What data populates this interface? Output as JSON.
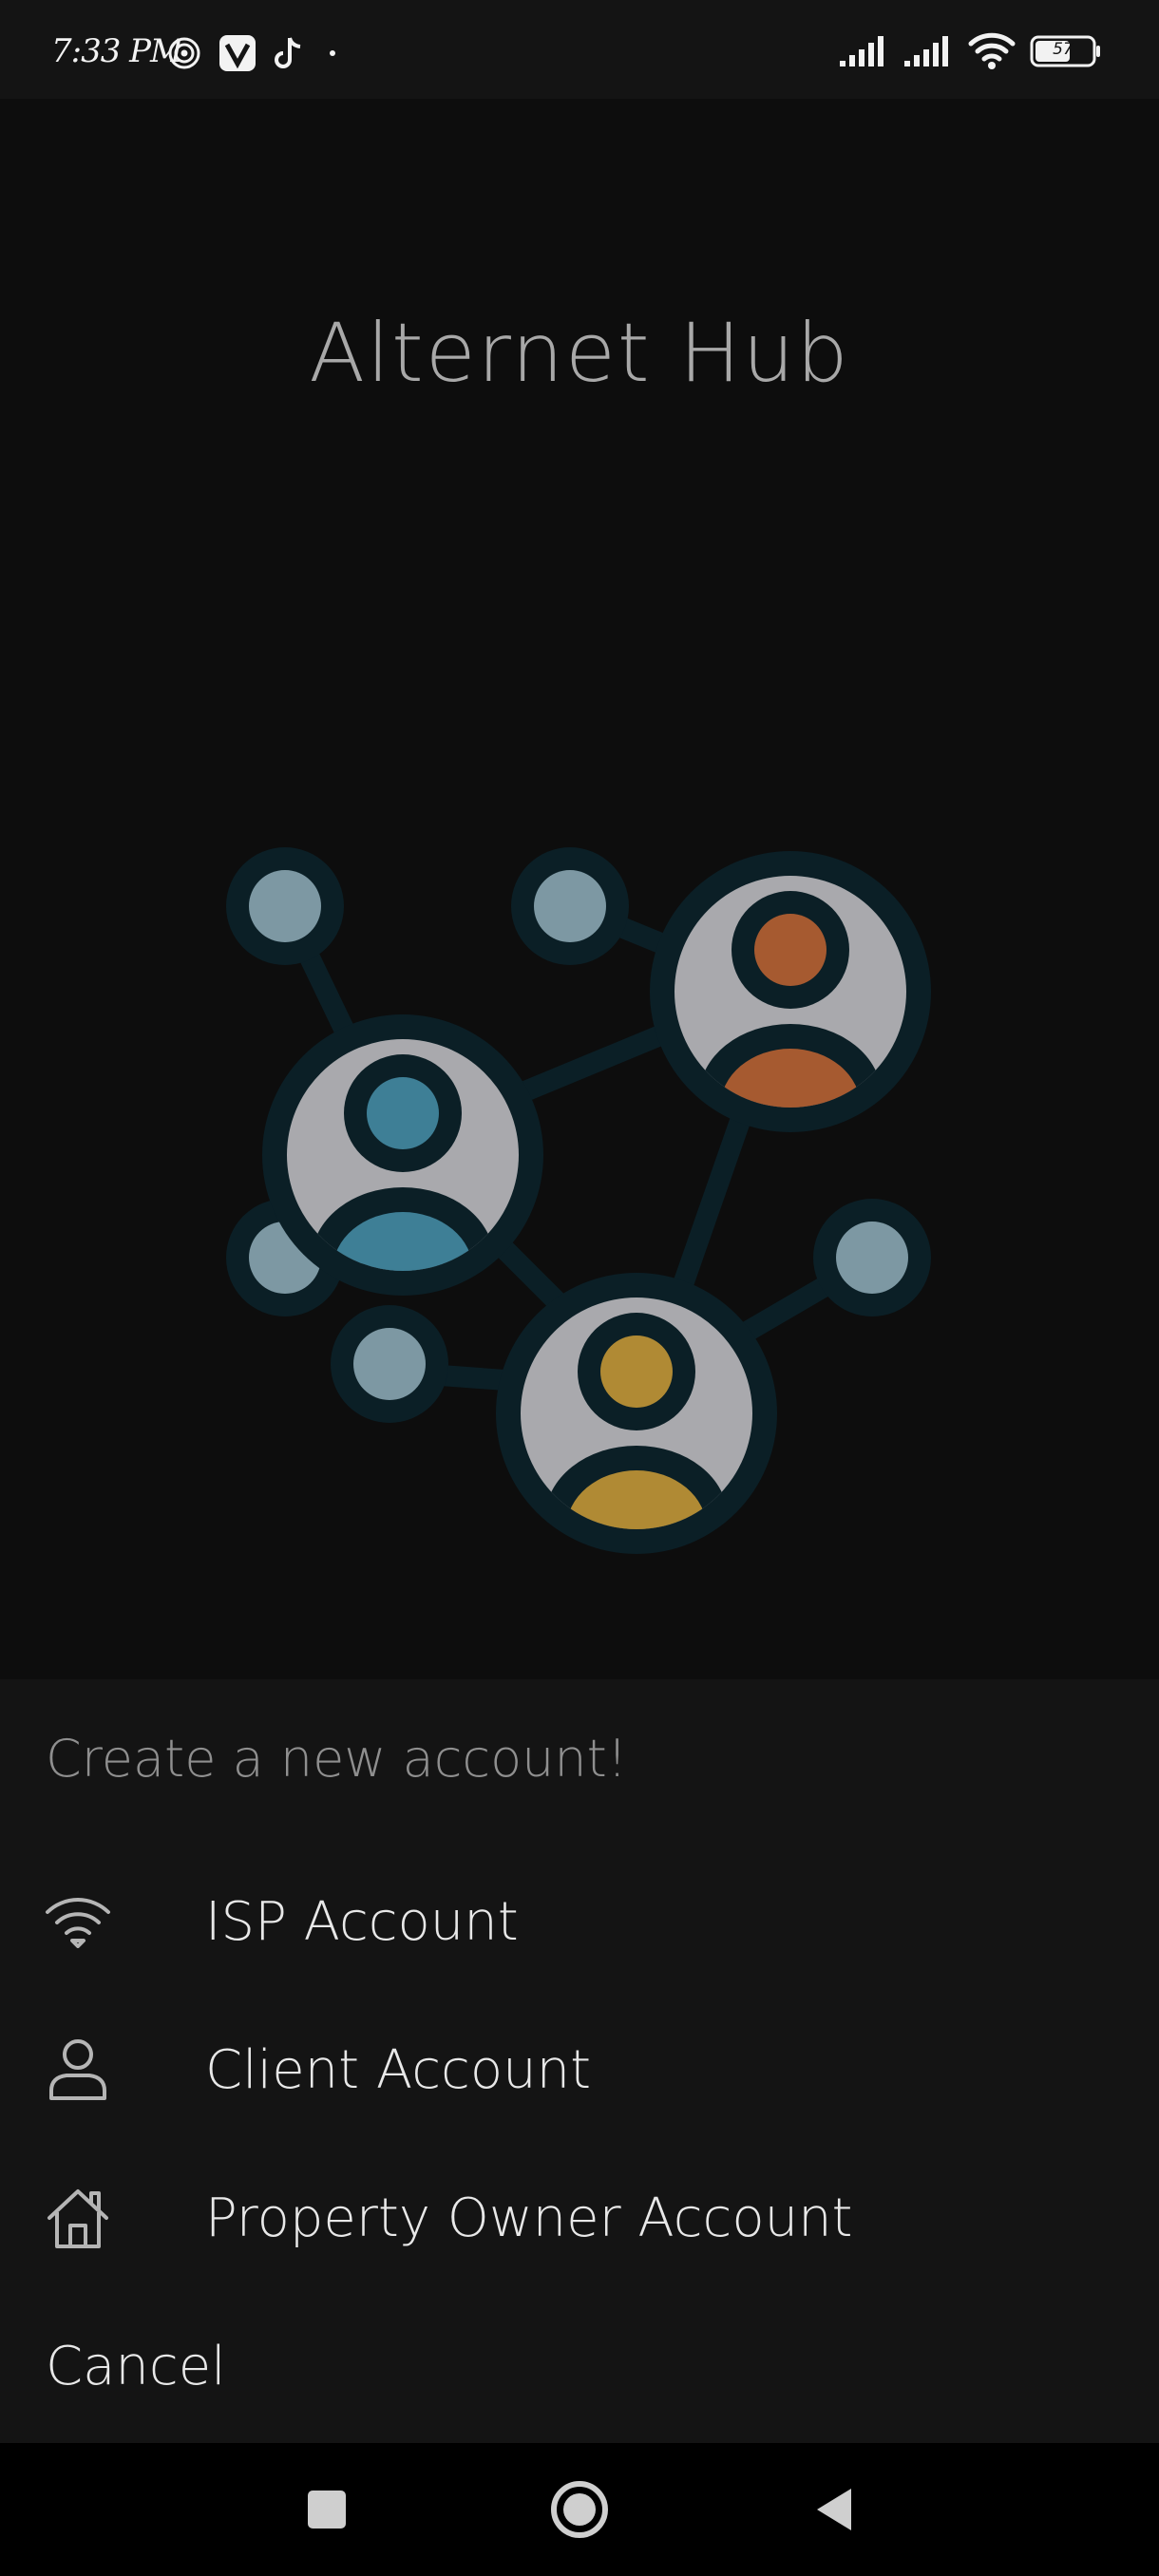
{
  "status_bar": {
    "time": "7:33 PM",
    "battery": "57",
    "icons": [
      "target-icon",
      "v-app-icon",
      "tiktok-icon",
      "dot-icon",
      "signal-icon",
      "signal-icon",
      "wifi-icon",
      "battery-icon"
    ]
  },
  "app": {
    "title": "Alternet Hub",
    "illustration": "network-people-illustration",
    "colors": {
      "node_dark": "#0b1f26",
      "node_light": "#7d98a3",
      "avatar_bg": "#a9a9ad",
      "person_orange": "#a65a30",
      "person_blue": "#3e7f96",
      "person_yellow": "#b08a34"
    }
  },
  "sheet": {
    "heading": "Create a new account!",
    "options": [
      {
        "label": "ISP Account",
        "icon": "wifi-icon"
      },
      {
        "label": "Client Account",
        "icon": "person-icon"
      },
      {
        "label": "Property Owner Account",
        "icon": "house-icon"
      }
    ],
    "cancel_label": "Cancel"
  },
  "nav_bar": {
    "buttons": [
      "recents-button",
      "home-button",
      "back-button"
    ]
  }
}
